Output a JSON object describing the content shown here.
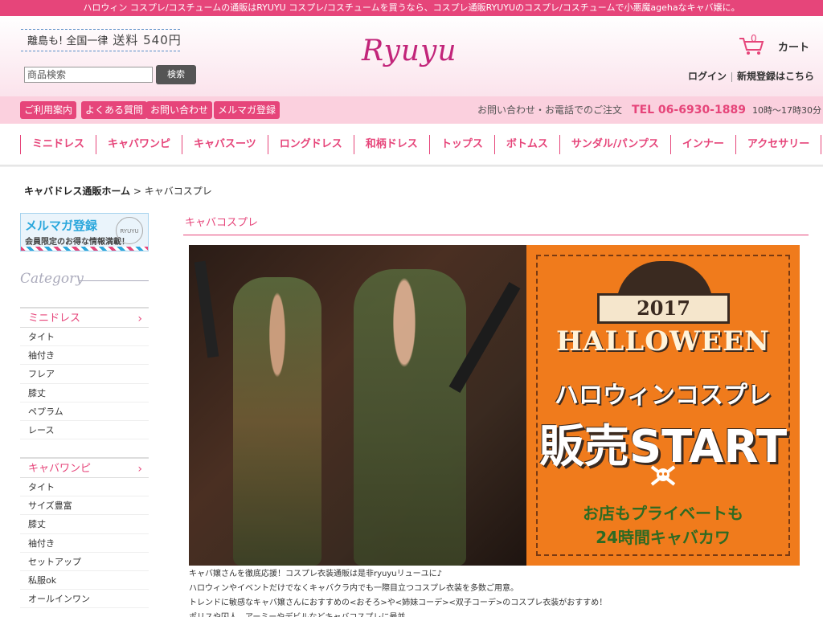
{
  "topbar": {
    "text": "ハロウィン コスプレ/コスチュームの通販はRYUYU コスプレ/コスチュームを買うなら、コスプレ通販RYUYUのコスプレ/コスチュームで小悪魔agehaなキャバ嬢に。"
  },
  "header": {
    "shipping_text": "離島も! 全国一律",
    "shipping_price": "送料 540円",
    "search_placeholder": "商品検索",
    "search_button": "検索",
    "logo": "Ryuyu",
    "cart_count": "0",
    "cart_label": "カート",
    "login": "ログイン",
    "register": "新規登録はこちら"
  },
  "subnav": {
    "pills": [
      "ご利用案内",
      "よくある質問",
      "お問い合わせ",
      "メルマガ登録"
    ],
    "contact_label": "お問い合わせ・お電話でのご注文",
    "tel": "TEL 06-6930-1889",
    "hours": "10時～17時30分"
  },
  "categories": [
    "ミニドレス",
    "キャバワンピ",
    "キャバスーツ",
    "ロングドレス",
    "和柄ドレス",
    "トップス",
    "ボトムス",
    "サンダル/パンプス",
    "インナー",
    "アクセサリー"
  ],
  "breadcrumb": {
    "home": "キャバドレス通販ホーム",
    "separator": ">",
    "current": "キャバコスプレ"
  },
  "sidebar": {
    "mm_title": "メルマガ登録",
    "mm_sub": "会員限定のお得な情報満載！",
    "mm_stamp": "RYUYU",
    "category_heading": "Category",
    "sections": [
      {
        "title": "ミニドレス",
        "items": [
          "タイト",
          "袖付き",
          "フレア",
          "膝丈",
          "ペプラム",
          "レース"
        ]
      },
      {
        "title": "キャバワンピ",
        "items": [
          "タイト",
          "サイズ豊富",
          "膝丈",
          "袖付き",
          "セットアップ",
          "私服ok",
          "オールインワン"
        ]
      }
    ]
  },
  "main": {
    "section_title": "キャバコスプレ",
    "banner": {
      "year": "2017",
      "title": "HALLOWEEN",
      "jp_title": "ハロウィンコスプレ",
      "sale": "販売START",
      "sub1": "お店もプライベートも",
      "sub2": "24時間キャバカワ"
    },
    "description": [
      "キャバ嬢さんを徹底応援！コスプレ衣装通販は是非ryuyuリューユに♪",
      "ハロウィンやイベントだけでなくキャバクラ内でも一際目立つコスプレ衣装を多数ご用意。",
      "トレンドに敏感なキャバ嬢さんにおすすめの<おそろ>や<姉妹コーデ><双子コーデ>のコスプレ衣装がおすすめ！",
      "ポリスや囚人、アーミーやデビルなどキャバコスプレに最並"
    ]
  },
  "colors": {
    "accent": "#e6457a",
    "banner_orange": "#f07b1c",
    "dark_brown": "#3a2a20"
  }
}
